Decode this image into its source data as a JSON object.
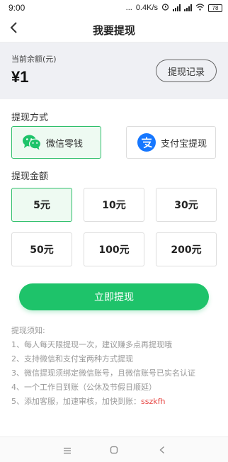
{
  "status_bar": {
    "time": "9:00",
    "dots": "...",
    "speed": "0.4K/s",
    "battery": "78"
  },
  "nav": {
    "title": "我要提现",
    "back_icon": "chevron-left-icon"
  },
  "balance": {
    "label": "当前余额(元)",
    "amount": "¥1",
    "record_button": "提现记录"
  },
  "method_section": {
    "title": "提现方式",
    "options": [
      {
        "label": "微信零钱",
        "icon": "wechat-icon",
        "selected": true
      },
      {
        "label": "支付宝提现",
        "icon": "alipay-icon",
        "selected": false
      }
    ]
  },
  "amount_section": {
    "title": "提现金额",
    "options": [
      {
        "label": "5元",
        "selected": true
      },
      {
        "label": "10元",
        "selected": false
      },
      {
        "label": "30元",
        "selected": false
      },
      {
        "label": "50元",
        "selected": false
      },
      {
        "label": "100元",
        "selected": false
      },
      {
        "label": "200元",
        "selected": false
      }
    ]
  },
  "confirm_button": "立即提现",
  "notes": {
    "title": "提现须知:",
    "items": [
      "1、每人每天限提现一次，建议赚多点再提现哦",
      "2、支持微信和支付宝两种方式提现",
      "3、微信提现须绑定微信账号，且微信账号已实名认证",
      "4、一个工作日到账（公休及节假日顺延）"
    ],
    "last_prefix": "5、添加客服，加速审核，加快到账：",
    "last_contact": "sszkfh"
  },
  "colors": {
    "accent_green": "#1ec36a",
    "selected_border": "#2fbf6b",
    "highlight_red": "#e64340",
    "panel_bg": "#eff0f4",
    "alipay_blue": "#1677ff"
  }
}
